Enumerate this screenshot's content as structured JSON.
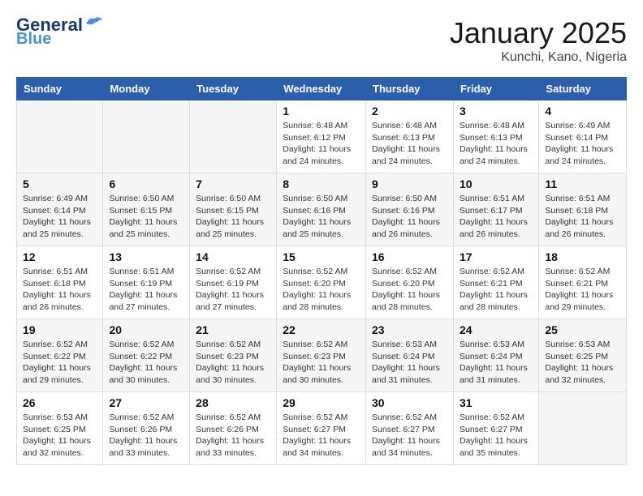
{
  "header": {
    "logo_line1": "General",
    "logo_line2": "Blue",
    "month": "January 2025",
    "location": "Kunchi, Kano, Nigeria"
  },
  "weekdays": [
    "Sunday",
    "Monday",
    "Tuesday",
    "Wednesday",
    "Thursday",
    "Friday",
    "Saturday"
  ],
  "weeks": [
    [
      {
        "day": "",
        "info": ""
      },
      {
        "day": "",
        "info": ""
      },
      {
        "day": "",
        "info": ""
      },
      {
        "day": "1",
        "info": "Sunrise: 6:48 AM\nSunset: 6:12 PM\nDaylight: 11 hours\nand 24 minutes."
      },
      {
        "day": "2",
        "info": "Sunrise: 6:48 AM\nSunset: 6:13 PM\nDaylight: 11 hours\nand 24 minutes."
      },
      {
        "day": "3",
        "info": "Sunrise: 6:48 AM\nSunset: 6:13 PM\nDaylight: 11 hours\nand 24 minutes."
      },
      {
        "day": "4",
        "info": "Sunrise: 6:49 AM\nSunset: 6:14 PM\nDaylight: 11 hours\nand 24 minutes."
      }
    ],
    [
      {
        "day": "5",
        "info": "Sunrise: 6:49 AM\nSunset: 6:14 PM\nDaylight: 11 hours\nand 25 minutes."
      },
      {
        "day": "6",
        "info": "Sunrise: 6:50 AM\nSunset: 6:15 PM\nDaylight: 11 hours\nand 25 minutes."
      },
      {
        "day": "7",
        "info": "Sunrise: 6:50 AM\nSunset: 6:15 PM\nDaylight: 11 hours\nand 25 minutes."
      },
      {
        "day": "8",
        "info": "Sunrise: 6:50 AM\nSunset: 6:16 PM\nDaylight: 11 hours\nand 25 minutes."
      },
      {
        "day": "9",
        "info": "Sunrise: 6:50 AM\nSunset: 6:16 PM\nDaylight: 11 hours\nand 26 minutes."
      },
      {
        "day": "10",
        "info": "Sunrise: 6:51 AM\nSunset: 6:17 PM\nDaylight: 11 hours\nand 26 minutes."
      },
      {
        "day": "11",
        "info": "Sunrise: 6:51 AM\nSunset: 6:18 PM\nDaylight: 11 hours\nand 26 minutes."
      }
    ],
    [
      {
        "day": "12",
        "info": "Sunrise: 6:51 AM\nSunset: 6:18 PM\nDaylight: 11 hours\nand 26 minutes."
      },
      {
        "day": "13",
        "info": "Sunrise: 6:51 AM\nSunset: 6:19 PM\nDaylight: 11 hours\nand 27 minutes."
      },
      {
        "day": "14",
        "info": "Sunrise: 6:52 AM\nSunset: 6:19 PM\nDaylight: 11 hours\nand 27 minutes."
      },
      {
        "day": "15",
        "info": "Sunrise: 6:52 AM\nSunset: 6:20 PM\nDaylight: 11 hours\nand 28 minutes."
      },
      {
        "day": "16",
        "info": "Sunrise: 6:52 AM\nSunset: 6:20 PM\nDaylight: 11 hours\nand 28 minutes."
      },
      {
        "day": "17",
        "info": "Sunrise: 6:52 AM\nSunset: 6:21 PM\nDaylight: 11 hours\nand 28 minutes."
      },
      {
        "day": "18",
        "info": "Sunrise: 6:52 AM\nSunset: 6:21 PM\nDaylight: 11 hours\nand 29 minutes."
      }
    ],
    [
      {
        "day": "19",
        "info": "Sunrise: 6:52 AM\nSunset: 6:22 PM\nDaylight: 11 hours\nand 29 minutes."
      },
      {
        "day": "20",
        "info": "Sunrise: 6:52 AM\nSunset: 6:22 PM\nDaylight: 11 hours\nand 30 minutes."
      },
      {
        "day": "21",
        "info": "Sunrise: 6:52 AM\nSunset: 6:23 PM\nDaylight: 11 hours\nand 30 minutes."
      },
      {
        "day": "22",
        "info": "Sunrise: 6:52 AM\nSunset: 6:23 PM\nDaylight: 11 hours\nand 30 minutes."
      },
      {
        "day": "23",
        "info": "Sunrise: 6:53 AM\nSunset: 6:24 PM\nDaylight: 11 hours\nand 31 minutes."
      },
      {
        "day": "24",
        "info": "Sunrise: 6:53 AM\nSunset: 6:24 PM\nDaylight: 11 hours\nand 31 minutes."
      },
      {
        "day": "25",
        "info": "Sunrise: 6:53 AM\nSunset: 6:25 PM\nDaylight: 11 hours\nand 32 minutes."
      }
    ],
    [
      {
        "day": "26",
        "info": "Sunrise: 6:53 AM\nSunset: 6:25 PM\nDaylight: 11 hours\nand 32 minutes."
      },
      {
        "day": "27",
        "info": "Sunrise: 6:52 AM\nSunset: 6:26 PM\nDaylight: 11 hours\nand 33 minutes."
      },
      {
        "day": "28",
        "info": "Sunrise: 6:52 AM\nSunset: 6:26 PM\nDaylight: 11 hours\nand 33 minutes."
      },
      {
        "day": "29",
        "info": "Sunrise: 6:52 AM\nSunset: 6:27 PM\nDaylight: 11 hours\nand 34 minutes."
      },
      {
        "day": "30",
        "info": "Sunrise: 6:52 AM\nSunset: 6:27 PM\nDaylight: 11 hours\nand 34 minutes."
      },
      {
        "day": "31",
        "info": "Sunrise: 6:52 AM\nSunset: 6:27 PM\nDaylight: 11 hours\nand 35 minutes."
      },
      {
        "day": "",
        "info": ""
      }
    ]
  ]
}
